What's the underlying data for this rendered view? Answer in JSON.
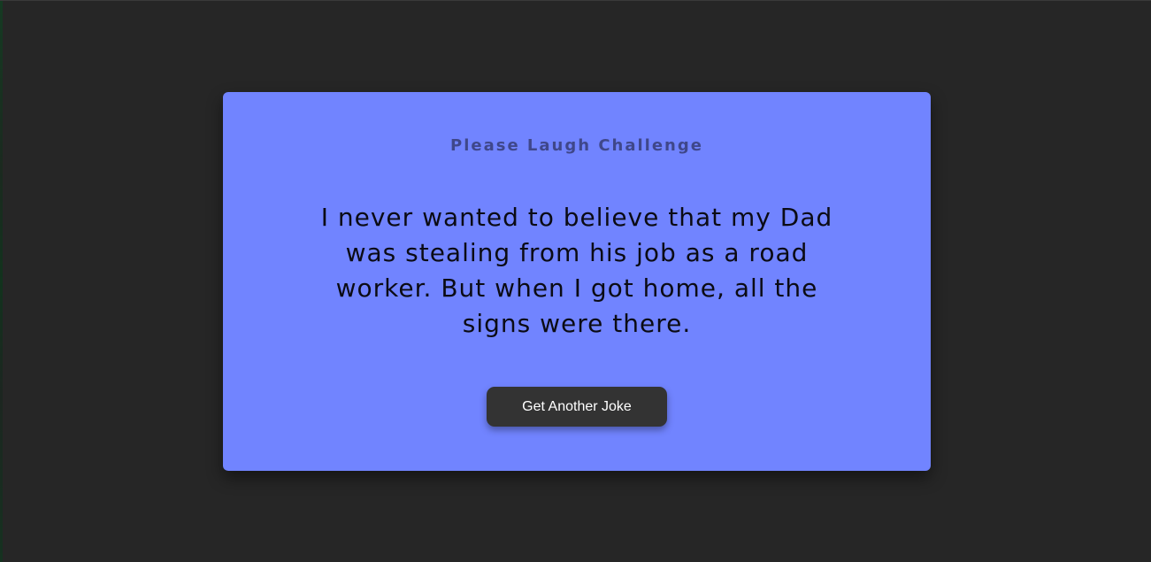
{
  "card": {
    "title": "Please Laugh Challenge",
    "joke": "I never wanted to believe that my Dad was stealing from his job as a road worker. But when I got home, all the signs were there.",
    "button_label": "Get Another Joke"
  },
  "colors": {
    "background": "#262626",
    "card": "#7184ff",
    "button": "#333333",
    "button_text": "#ffffff"
  }
}
